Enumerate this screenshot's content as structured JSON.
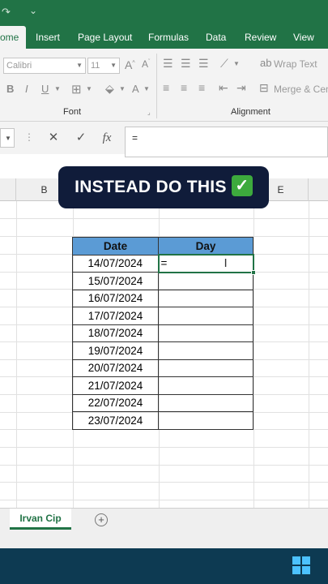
{
  "ribbon_tabs": [
    {
      "label": "ome",
      "active": true
    },
    {
      "label": "Insert"
    },
    {
      "label": "Page Layout"
    },
    {
      "label": "Formulas"
    },
    {
      "label": "Data"
    },
    {
      "label": "Review"
    },
    {
      "label": "View"
    }
  ],
  "font": {
    "name": "Calibri",
    "size": "11",
    "group_label": "Font",
    "bold": "B",
    "italic": "I",
    "underline": "U"
  },
  "alignment": {
    "wrap_text": "Wrap Text",
    "merge_center": "Merge & Cen",
    "group_label": "Alignment"
  },
  "formula_bar": {
    "fx": "fx",
    "value": "="
  },
  "columns": [
    "B",
    "E"
  ],
  "overlay_text": "INSTEAD DO THIS",
  "table": {
    "headers": [
      "Date",
      "Day"
    ],
    "dates": [
      "14/07/2024",
      "15/07/2024",
      "16/07/2024",
      "17/07/2024",
      "18/07/2024",
      "19/07/2024",
      "20/07/2024",
      "21/07/2024",
      "22/07/2024",
      "23/07/2024"
    ],
    "active_cell_value": "="
  },
  "sheet": {
    "tab_name": "Irvan Cip",
    "add_symbol": "+"
  },
  "colors": {
    "excel_green": "#217346",
    "header_blue": "#5b9bd5",
    "overlay_bg": "#101c3a",
    "taskbar": "#0d3a52"
  }
}
